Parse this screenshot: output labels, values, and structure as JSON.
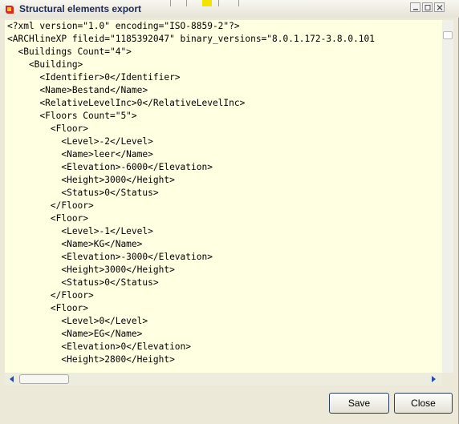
{
  "window": {
    "title": "Structural elements export"
  },
  "lines": [
    "<?xml version=\"1.0\" encoding=\"ISO-8859-2\"?>",
    "<ARCHlineXP fileid=\"1185392047\" binary_versions=\"8.0.1.172-3.8.0.101",
    "  <Buildings Count=\"4\">",
    "    <Building>",
    "      <Identifier>0</Identifier>",
    "      <Name>Bestand</Name>",
    "      <RelativeLevelInc>0</RelativeLevelInc>",
    "      <Floors Count=\"5\">",
    "        <Floor>",
    "          <Level>-2</Level>",
    "          <Name>leer</Name>",
    "          <Elevation>-6000</Elevation>",
    "          <Height>3000</Height>",
    "          <Status>0</Status>",
    "        </Floor>",
    "        <Floor>",
    "          <Level>-1</Level>",
    "          <Name>KG</Name>",
    "          <Elevation>-3000</Elevation>",
    "          <Height>3000</Height>",
    "          <Status>0</Status>",
    "        </Floor>",
    "        <Floor>",
    "          <Level>0</Level>",
    "          <Name>EG</Name>",
    "          <Elevation>0</Elevation>",
    "          <Height>2800</Height>"
  ],
  "buttons": {
    "save": "Save",
    "close": "Close"
  },
  "icons": {
    "app": "ARCHline-app-icon",
    "minimize": "minimize-icon",
    "maximize": "maximize-icon",
    "close": "close-icon",
    "scroll_left": "scroll-left-arrow-icon",
    "scroll_right": "scroll-right-arrow-icon"
  },
  "colors": {
    "editor_background": "#ffffe1",
    "title_text": "#1c2a55",
    "scroll_arrow": "#2b4aa8",
    "dialog_background": "#ece9d8"
  }
}
